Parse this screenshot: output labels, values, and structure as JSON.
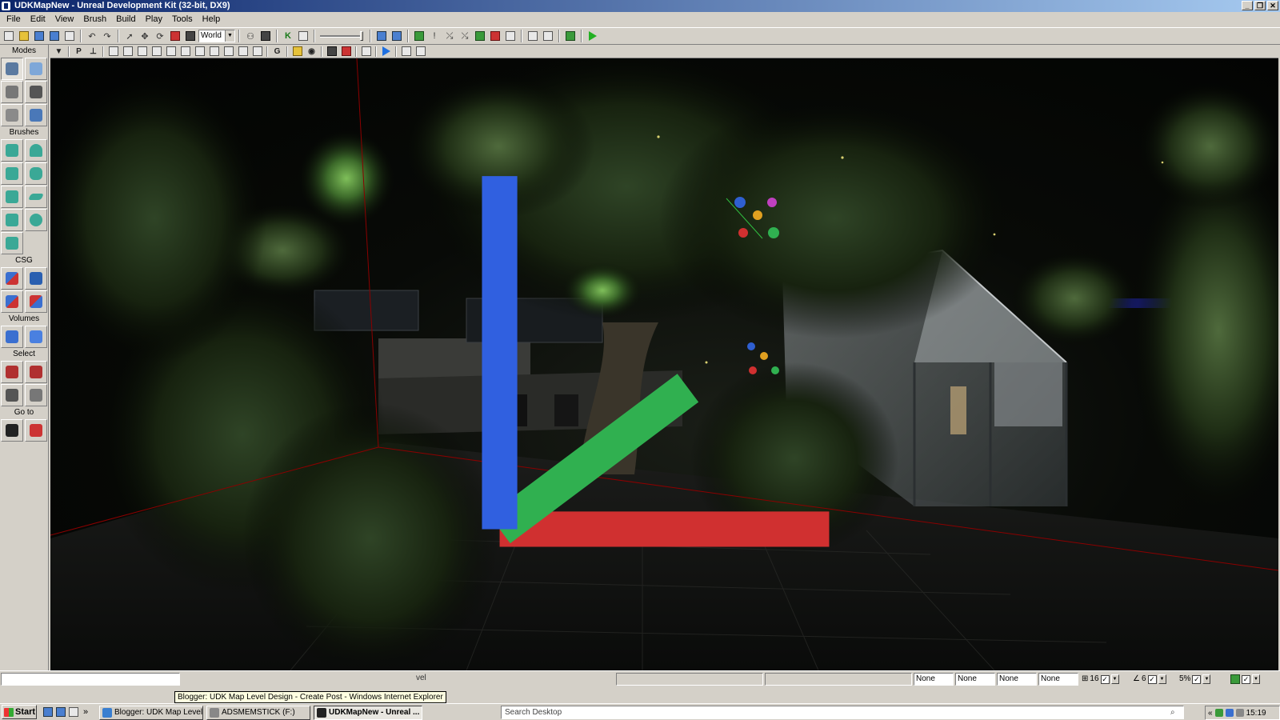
{
  "window": {
    "title": "UDKMapNew - Unreal Development Kit (32-bit, DX9)",
    "controls": [
      "_",
      "❐",
      "✕"
    ]
  },
  "menu": [
    "File",
    "Edit",
    "View",
    "Brush",
    "Build",
    "Play",
    "Tools",
    "Help"
  ],
  "toolbar": {
    "coord_system": "World",
    "play_icon": "play-in-editor-icon"
  },
  "modes_panel": {
    "sections": [
      {
        "label": "Modes",
        "buttons": [
          "camera-mode-icon",
          "geometry-mode-icon",
          "terrain-mode-icon",
          "move-mode-icon",
          "paint-mode-icon",
          "mesh-paint-icon"
        ]
      },
      {
        "label": "Brushes",
        "buttons": [
          "cube-brush-icon",
          "cone-brush-icon",
          "stairs-brush-icon",
          "cylinder-brush-icon",
          "curved-stairs-brush-icon",
          "sheet-brush-icon",
          "spiral-stairs-brush-icon",
          "sphere-brush-icon",
          "volumetric-brush-icon"
        ]
      },
      {
        "label": "CSG",
        "buttons": [
          "csg-add-icon",
          "csg-subtract-icon",
          "csg-intersect-icon",
          "csg-deintersect-icon"
        ]
      },
      {
        "label": "Volumes",
        "buttons": [
          "add-volume-icon",
          "blocking-volume-icon"
        ]
      },
      {
        "label": "Select",
        "buttons": [
          "show-selected-icon",
          "hide-selected-icon",
          "select-inside-icon",
          "invert-selection-icon"
        ]
      },
      {
        "label": "Go to",
        "buttons": [
          "go-to-actor-icon",
          "go-to-builder-brush-icon"
        ]
      }
    ]
  },
  "viewport_toolbar": {
    "perspective_label": "P",
    "grid_label": "G"
  },
  "statusbar": {
    "command_value": "",
    "message_tail": "vel",
    "layer_fields": [
      "None",
      "None",
      "None",
      "None"
    ],
    "grid_snap": "16",
    "rotation_snap": "6",
    "scale_snap": "5%",
    "checks": [
      "✓",
      "✓",
      "✓",
      "✓"
    ]
  },
  "tooltip": "Blogger: UDK Map Level Design - Create Post - Windows Internet Explorer",
  "taskbar": {
    "start_label": "Start",
    "overflow": "»",
    "tasks": [
      {
        "label": "Blogger: UDK Map Level ...",
        "icon": "internet-explorer-icon"
      },
      {
        "label": "ADSMEMSTICK (F:)",
        "icon": "removable-drive-icon"
      },
      {
        "label": "UDKMapNew - Unreal ...",
        "icon": "unreal-editor-icon",
        "active": true
      }
    ],
    "search_placeholder": "Search Desktop",
    "tray_chevron": "«",
    "clock": "15:19"
  },
  "colors": {
    "window_chrome": "#d4d0c8",
    "titlebar_start": "#0a246a",
    "titlebar_end": "#a6caf0",
    "viewport_bg": "#000000",
    "bsp_grid_red": "#8b0000"
  }
}
